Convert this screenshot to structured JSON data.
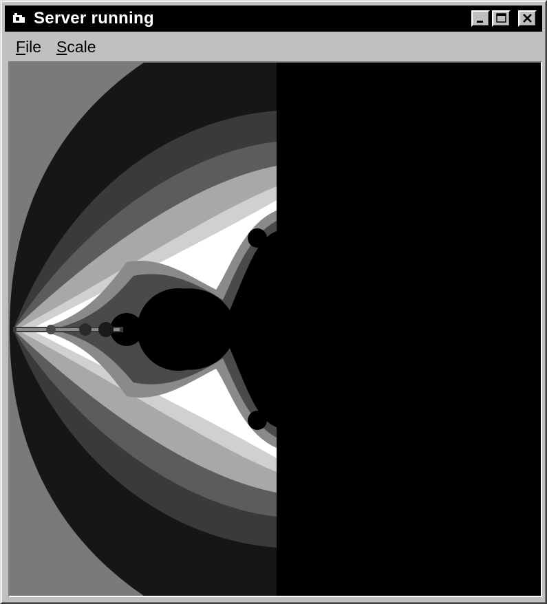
{
  "window": {
    "title": "Server running",
    "controls": [
      "minimize",
      "maximize",
      "close"
    ]
  },
  "menu": {
    "items": [
      {
        "label_accel": "F",
        "label_rest": "ile"
      },
      {
        "label_accel": "S",
        "label_rest": "cale"
      }
    ]
  },
  "canvas": {
    "content": "mandelbrot-fractal-render",
    "colors": {
      "background": "#000000",
      "band_outer": "#7a7a7a",
      "band_dark1": "#161616",
      "band_dark2": "#3a3a3a",
      "band_mid": "#5c5c5c",
      "band_light": "#a8a8a8",
      "band_lighter": "#d0d0d0",
      "band_white": "#ffffff"
    }
  }
}
